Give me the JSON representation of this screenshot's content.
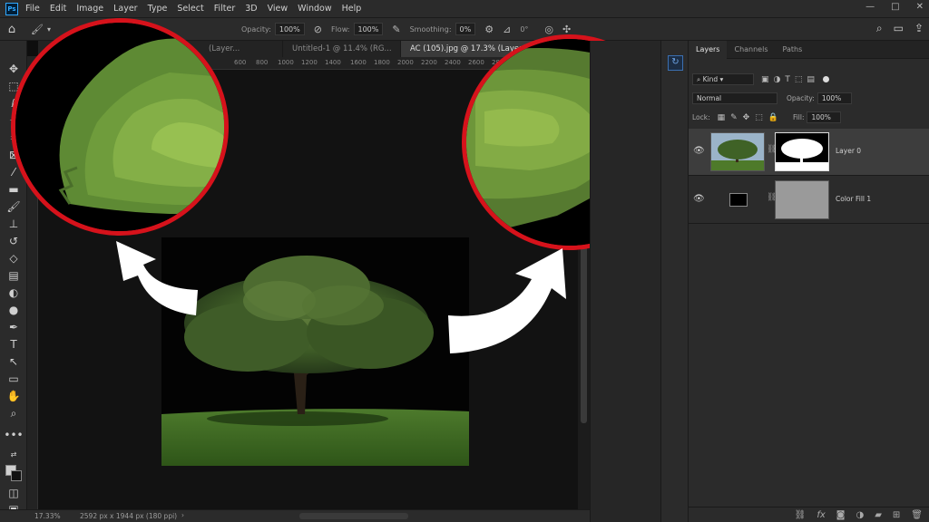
{
  "menubar": {
    "logo": "Ps",
    "items": [
      "File",
      "Edit",
      "Image",
      "Layer",
      "Type",
      "Select",
      "Filter",
      "3D",
      "View",
      "Window",
      "Help"
    ],
    "window_controls": [
      "—",
      "□",
      "✕"
    ]
  },
  "options": {
    "opacity_label": "Opacity:",
    "opacity_value": "100%",
    "flow_label": "Flow:",
    "flow_value": "100%",
    "smoothing_label": "Smoothing:",
    "smoothing_value": "0%",
    "angle_value": "0°"
  },
  "tabs": [
    {
      "label": "(Layer...",
      "active": false
    },
    {
      "label": "Untitled-1 @ 11.4% (RG...",
      "active": false
    },
    {
      "label": "AC (105).jpg @ 17.3% (Layer 0, Layer...",
      "active": true
    }
  ],
  "ruler": {
    "ticks": [
      "200",
      "600",
      "800",
      "1000",
      "1200",
      "1400",
      "1600",
      "1800",
      "2000",
      "2200",
      "2400",
      "2600",
      "2800"
    ]
  },
  "statusbar": {
    "zoom": "17.33%",
    "doc_info": "2592 px x 1944 px (180 ppi)",
    "arrow": "›"
  },
  "layers_panel": {
    "tabs": [
      "Layers",
      "Channels",
      "Paths"
    ],
    "filter_kind": "Kind",
    "blend_mode": "Normal",
    "opacity_label": "Opacity:",
    "opacity_value": "100%",
    "lock_label": "Lock:",
    "fill_label": "Fill:",
    "fill_value": "100%",
    "layers": [
      {
        "name": "Layer 0",
        "selected": true
      },
      {
        "name": "Color Fill 1",
        "selected": false
      }
    ],
    "footer_icons": [
      "link-icon",
      "fx-icon",
      "mask-icon",
      "adjustment-icon",
      "group-icon",
      "new-layer-icon",
      "trash-icon"
    ]
  },
  "colors": {
    "accent_circle": "#d6121b",
    "panel_bg": "#2b2b2b",
    "selected_layer": "#3d3d3d",
    "color_fill_swatch": "#9a9a9a"
  }
}
